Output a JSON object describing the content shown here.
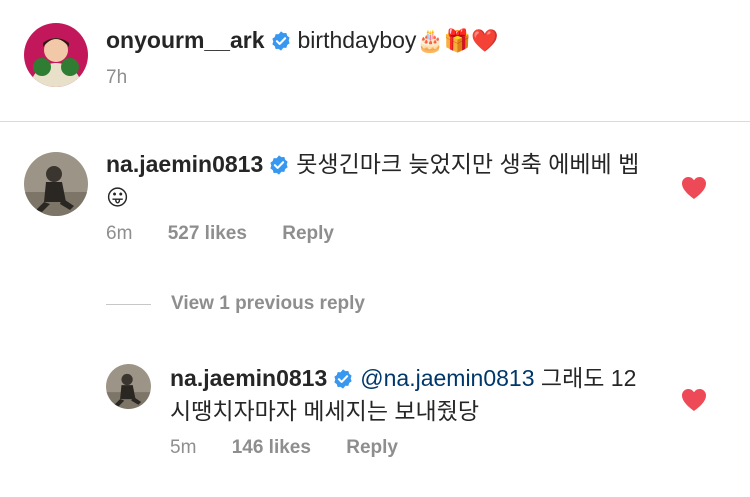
{
  "caption": {
    "username": "onyourm__ark",
    "text": "birthdayboy",
    "emojis": [
      "🎂",
      "🎁",
      "❤️"
    ],
    "time": "7h"
  },
  "comment": {
    "username": "na.jaemin0813",
    "text": "못생긴마크 늦었지만 생축 에베베 벱",
    "emoji": "😛",
    "time": "6m",
    "likes": "527 likes",
    "reply": "Reply"
  },
  "view_previous": "View 1 previous reply",
  "reply_comment": {
    "username": "na.jaemin0813",
    "mention": "@na.jaemin0813",
    "text": "그래도 12시땡치자마자 메세지는 보내줬당",
    "time": "5m",
    "likes": "146 likes",
    "reply": "Reply"
  },
  "colors": {
    "verified": "#3897f0",
    "heart": "#ed4956",
    "secondary_text": "#8e8e8e",
    "mention": "#00376b"
  }
}
